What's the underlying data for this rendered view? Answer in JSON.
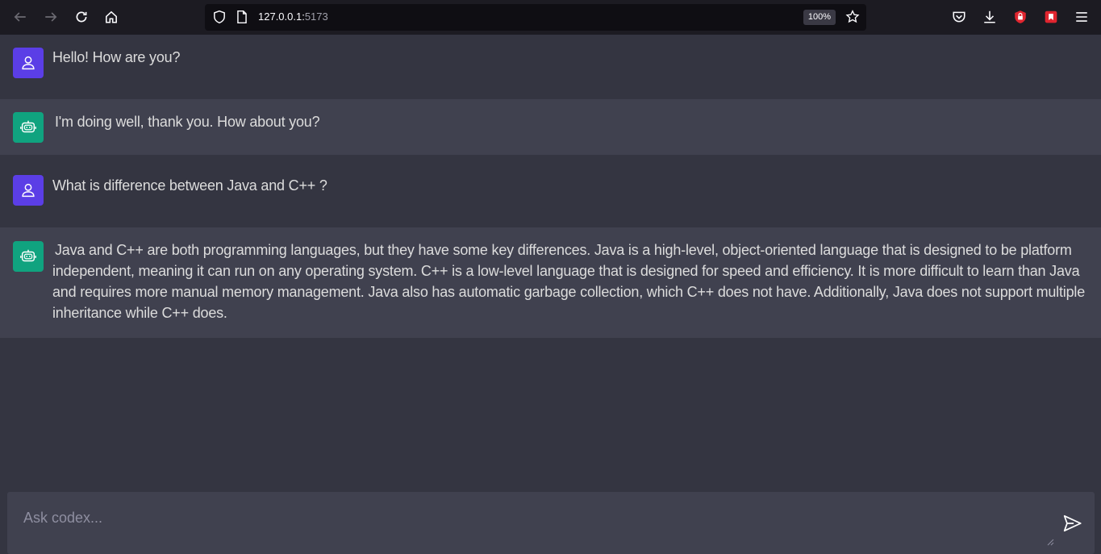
{
  "browser": {
    "url_host": "127.0.0.1:",
    "url_port": "5173",
    "zoom": "100%",
    "icons": {
      "back": "back-arrow-icon",
      "forward": "forward-arrow-icon",
      "reload": "reload-icon",
      "home": "home-icon",
      "shield": "tracking-shield-icon",
      "page": "page-icon",
      "bookmark": "star-icon",
      "pocket": "pocket-icon",
      "downloads": "download-icon",
      "ext1": "lock-extension-icon",
      "ext2": "save-extension-icon",
      "menu": "hamburger-menu-icon"
    }
  },
  "messages": [
    {
      "role": "user",
      "text": "Hello! How are you?"
    },
    {
      "role": "bot",
      "text": "I'm doing well, thank you. How about you?"
    },
    {
      "role": "user",
      "text": "What is difference between Java and C++ ?"
    },
    {
      "role": "bot",
      "text": "Java and C++ are both programming languages, but they have some key differences. Java is a high-level, object-oriented language that is designed to be platform independent, meaning it can run on any operating system. C++ is a low-level language that is designed for speed and efficiency. It is more difficult to learn than Java and requires more manual memory management. Java also has automatic garbage collection, which C++ does not have. Additionally, Java does not support multiple inheritance while C++ does."
    }
  ],
  "input": {
    "placeholder": "Ask codex...",
    "value": ""
  },
  "colors": {
    "user_avatar": "#5b3ee6",
    "bot_avatar": "#10a37f",
    "bg_user": "#343541",
    "bg_bot": "#40414f"
  }
}
